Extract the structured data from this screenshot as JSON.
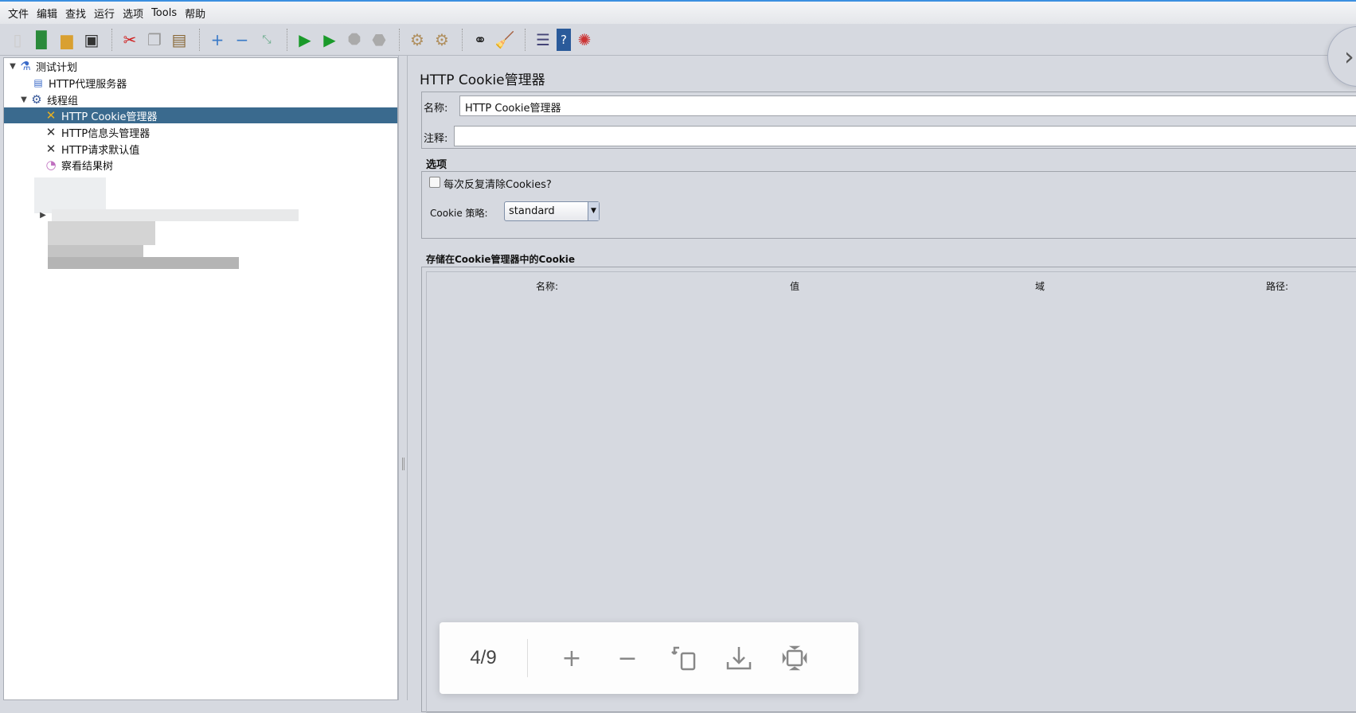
{
  "menu": [
    "文件",
    "编辑",
    "查找",
    "运行",
    "选项",
    "Tools",
    "帮助"
  ],
  "toolbar": [
    "new-icon",
    "templates-icon",
    "open-icon",
    "save-icon",
    "cut-icon",
    "copy-icon",
    "paste-icon",
    "expand-icon",
    "collapse-icon",
    "toggle-icon",
    "start-icon",
    "start-no-pause-icon",
    "stop-icon",
    "shutdown-icon",
    "clear-icon",
    "clear-all-icon",
    "search-icon",
    "reset-search-icon",
    "function-helper-icon",
    "help-icon",
    "remote-icon"
  ],
  "tree": {
    "items": [
      {
        "label": "测试计划",
        "icon": "test-plan-icon",
        "level": 0,
        "expanded": true
      },
      {
        "label": "HTTP代理服务器",
        "icon": "proxy-icon",
        "level": 1
      },
      {
        "label": "线程组",
        "icon": "thread-group-icon",
        "level": 1,
        "expanded": true
      },
      {
        "label": "HTTP Cookie管理器",
        "icon": "config-element-icon",
        "level": 2,
        "selected": true
      },
      {
        "label": "HTTP信息头管理器",
        "icon": "config-element-icon",
        "level": 2
      },
      {
        "label": "HTTP请求默认值",
        "icon": "config-element-icon",
        "level": 2
      },
      {
        "label": "察看结果树",
        "icon": "listener-icon",
        "level": 2
      }
    ]
  },
  "panel": {
    "title": "HTTP Cookie管理器",
    "name_label": "名称:",
    "name_value": "HTTP Cookie管理器",
    "comment_label": "注释:",
    "comment_value": "",
    "options_label": "选项",
    "clear_each_iteration_label": "每次反复清除Cookies?",
    "clear_each_iteration_checked": false,
    "policy_label": "Cookie 策略:",
    "policy_value": "standard",
    "stored_label": "存储在Cookie管理器中的Cookie",
    "columns": [
      "名称:",
      "值",
      "域",
      "路径:"
    ]
  },
  "viewer": {
    "page": "4/9"
  }
}
